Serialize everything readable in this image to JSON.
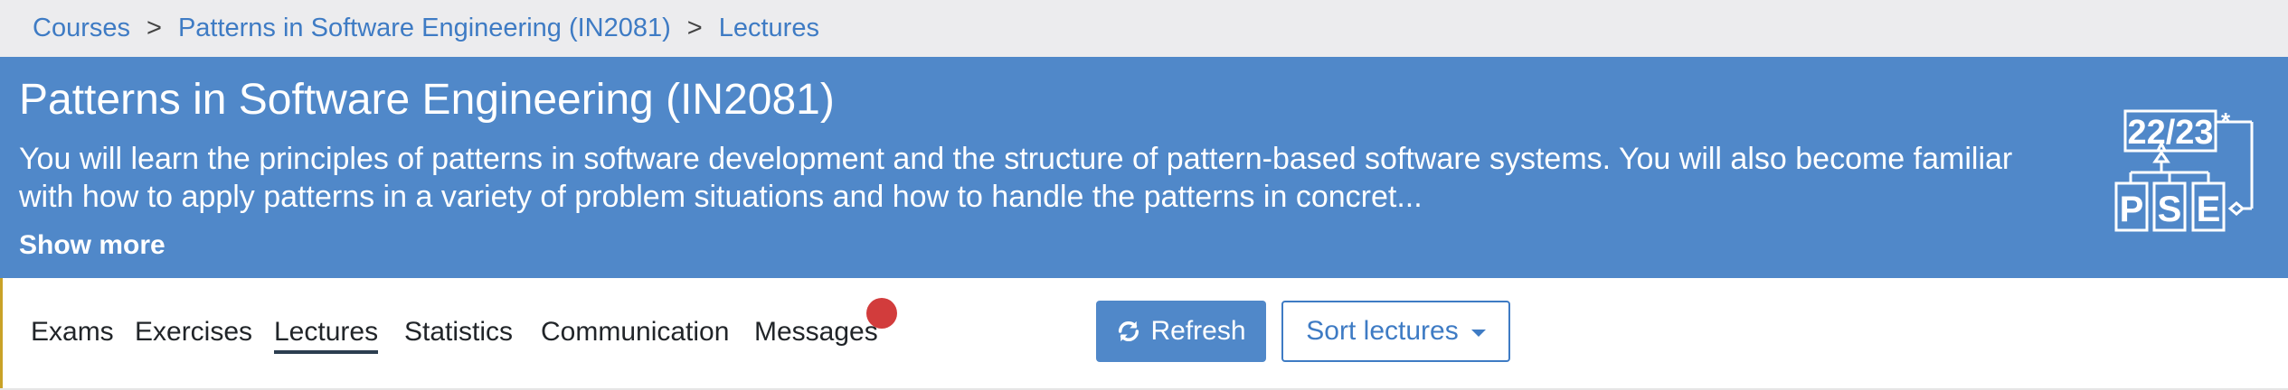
{
  "breadcrumb": {
    "items": [
      "Courses",
      "Patterns in Software Engineering (IN2081)",
      "Lectures"
    ],
    "separator": ">"
  },
  "course": {
    "title": "Patterns in Software Engineering (IN2081)",
    "description": "You will learn the principles of patterns in software development and the structure of pattern-based software systems. You will also become familiar with how to apply patterns in a variety of problem situations and how to handle the patterns in concret...",
    "show_more_label": "Show more",
    "logo": {
      "semester": "22/23",
      "star": "*",
      "letters": [
        "P",
        "S",
        "E"
      ]
    }
  },
  "tabs": [
    {
      "label": "Exams",
      "active": false
    },
    {
      "label": "Exercises",
      "active": false
    },
    {
      "label": "Lectures",
      "active": true
    },
    {
      "label": "Statistics",
      "active": false
    },
    {
      "label": "Communication",
      "active": false
    },
    {
      "label": "Messages",
      "active": false,
      "notification": true
    }
  ],
  "actions": {
    "refresh_label": "Refresh",
    "sort_label": "Sort lectures"
  },
  "colors": {
    "header_bg": "#5088c9",
    "link": "#3e7bc4",
    "notification": "#d23c3c"
  }
}
